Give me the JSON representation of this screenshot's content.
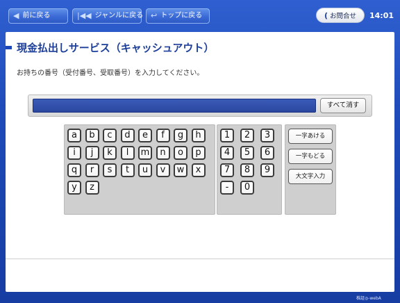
{
  "nav": {
    "back_label": "前に戻る",
    "genre_label": "ジャンルに戻る",
    "top_label": "トップに戻る"
  },
  "header": {
    "inquiry_label": "お問合せ",
    "time": "14:01"
  },
  "page": {
    "title": "現金払出しサービス（キャッシュアウト）",
    "instruction": "お持ちの番号（受付番号、受取番号）を入力してください。"
  },
  "input": {
    "value": "",
    "clear_label": "すべて消す"
  },
  "keyboard": {
    "letters": [
      "a",
      "b",
      "c",
      "d",
      "e",
      "f",
      "g",
      "h",
      "i",
      "j",
      "k",
      "l",
      "m",
      "n",
      "o",
      "p",
      "q",
      "r",
      "s",
      "t",
      "u",
      "v",
      "w",
      "x",
      "y",
      "z"
    ],
    "digits": [
      "1",
      "2",
      "3",
      "4",
      "5",
      "6",
      "7",
      "8",
      "9",
      "-",
      "0"
    ],
    "functions": [
      "一字あける",
      "一字もどる",
      "大文字入力"
    ]
  },
  "footer": {
    "label": "株証◎-webA"
  },
  "colors": {
    "brand_blue": "#1e49b8",
    "title_blue": "#1d3f9a",
    "input_blue": "#2b47a0"
  }
}
